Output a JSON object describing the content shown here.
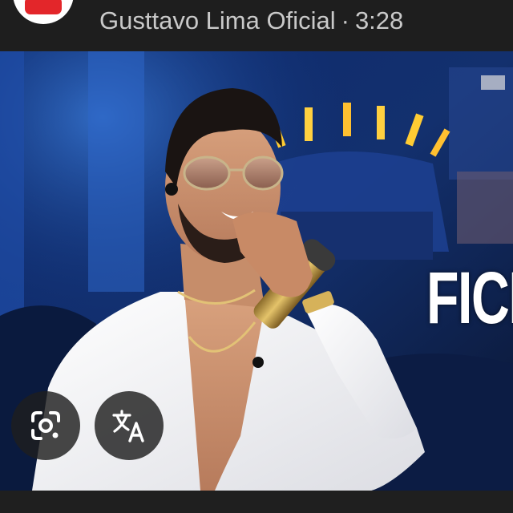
{
  "header": {
    "logo_icon": "youtube-logo-icon",
    "channel_name": "Gusttavo Lima Oficial",
    "separator": "·",
    "duration": "3:28"
  },
  "thumbnail": {
    "overlay_text": "FICI"
  },
  "actions": {
    "lens_icon": "google-lens-icon",
    "translate_icon": "translate-icon"
  },
  "colors": {
    "background": "#1f1f1f",
    "header_text": "#c9c9c9",
    "youtube_red": "#e3262a"
  }
}
